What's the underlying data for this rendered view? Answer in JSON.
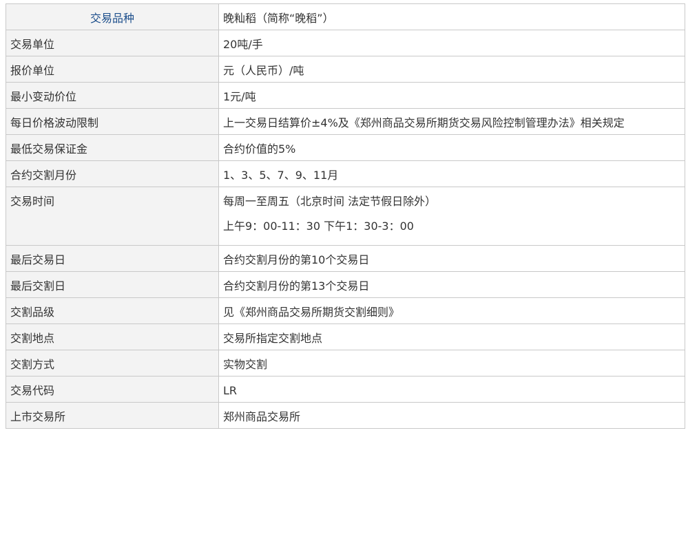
{
  "table": {
    "rows": [
      {
        "label": "交易品种",
        "value": "晚籼稻（简称“晚稻”）"
      },
      {
        "label": "交易单位",
        "value": "20吨/手"
      },
      {
        "label": "报价单位",
        "value": "元（人民币）/吨"
      },
      {
        "label": "最小变动价位",
        "value": "1元/吨"
      },
      {
        "label": "每日价格波动限制",
        "value": "上一交易日结算价±4%及《郑州商品交易所期货交易风险控制管理办法》相关规定"
      },
      {
        "label": "最低交易保证金",
        "value": "合约价值的5%"
      },
      {
        "label": "合约交割月份",
        "value": "1、3、5、7、9、11月"
      },
      {
        "label": "交易时间",
        "value": "每周一至周五（北京时间 法定节假日除外）",
        "value2": "上午9：00-11：30 下午1：30-3：00"
      },
      {
        "label": "最后交易日",
        "value": "合约交割月份的第10个交易日"
      },
      {
        "label": "最后交割日",
        "value": "合约交割月份的第13个交易日"
      },
      {
        "label": "交割品级",
        "value": "见《郑州商品交易所期货交割细则》"
      },
      {
        "label": "交割地点",
        "value": "交易所指定交割地点"
      },
      {
        "label": "交割方式",
        "value": "实物交割"
      },
      {
        "label": "交易代码",
        "value": "LR"
      },
      {
        "label": "上市交易所",
        "value": "郑州商品交易所"
      }
    ]
  }
}
